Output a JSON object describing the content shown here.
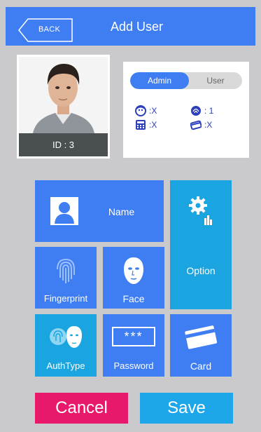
{
  "header": {
    "back_label": "BACK",
    "title": "Add User"
  },
  "profile": {
    "id_label": "ID : 3"
  },
  "role_toggle": {
    "admin_label": "Admin",
    "user_label": "User",
    "selected": "Admin"
  },
  "stats": {
    "face": ":X",
    "fingerprint": ": 1",
    "password": ":X",
    "card": ":X"
  },
  "tiles": {
    "name": "Name",
    "option": "Option",
    "fingerprint": "Fingerprint",
    "face": "Face",
    "authtype": "AuthType",
    "password": "Password",
    "password_mask": "***",
    "card": "Card"
  },
  "actions": {
    "cancel": "Cancel",
    "save": "Save"
  },
  "colors": {
    "primary": "#3f7df2",
    "accent": "#1ba5e0",
    "cancel": "#e8196a",
    "save": "#1ea6ea"
  }
}
